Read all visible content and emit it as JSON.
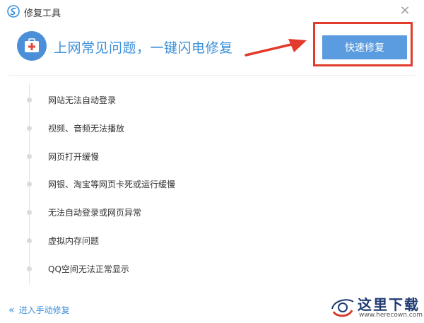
{
  "window": {
    "title": "修复工具",
    "close_label": "×"
  },
  "header": {
    "headline": "上网常见问题，一键闪电修复",
    "repair_button": "快速修复"
  },
  "issues": [
    "网站无法自动登录",
    "视频、音频无法播放",
    "网页打开缓慢",
    "网银、淘宝等网页卡死或运行缓慢",
    "无法自动登录或网页异常",
    "虚拟内存问题",
    "QQ空间无法正常显示"
  ],
  "footer": {
    "manual_link": "进入手动修复",
    "chevron": "«"
  },
  "watermark": {
    "text": "这里下载",
    "url": "www.herecown.com"
  },
  "colors": {
    "accent": "#3a8fd9",
    "button": "#5b9bdf",
    "highlight": "#e23a2b",
    "medkit": "#4a8fd8"
  }
}
